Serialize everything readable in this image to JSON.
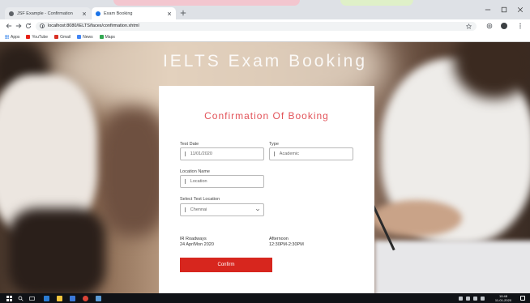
{
  "browser": {
    "tabs": [
      {
        "title": "JSF Example - Confirmation",
        "icon": "page-favicon"
      },
      {
        "title": "Exam Booking",
        "icon": "page-favicon"
      }
    ],
    "url": "localhost:8080/IELTS/faces/confirmation.xhtml",
    "bookmarks": [
      {
        "label": "Apps",
        "icon": "apps-grid-icon",
        "color": "#1a73e8"
      },
      {
        "label": "YouTube",
        "icon": "youtube-icon",
        "color": "#e62117"
      },
      {
        "label": "Gmail",
        "icon": "gmail-icon",
        "color": "#d93025"
      },
      {
        "label": "News",
        "icon": "news-icon",
        "color": "#4285f4"
      },
      {
        "label": "Maps",
        "icon": "maps-icon",
        "color": "#34a853"
      }
    ]
  },
  "page": {
    "title": "IELTS Exam Booking"
  },
  "booking": {
    "heading": "Confirmation Of Booking",
    "test_date": {
      "label": "Test Date",
      "value": "11/01/2020"
    },
    "type": {
      "label": "Type",
      "value": "Academic"
    },
    "location_name": {
      "label": "Location Name",
      "value": "Location"
    },
    "test_location": {
      "label": "Select Test Location",
      "value": "Chennai"
    },
    "slot_left": {
      "line1": "IR Roadways",
      "line2": "24 Apr/Mon 2020"
    },
    "slot_right": {
      "line1": "Afternoon",
      "line2": "12:30PM-2:30PM"
    },
    "confirm_label": "Confirm"
  },
  "taskbar": {
    "time": "10:48",
    "date": "11-01-2020",
    "apps": [
      {
        "icon": "edge-icon",
        "color": "#2b7cd3"
      },
      {
        "icon": "file-explorer-icon",
        "color": "#f2c53d"
      },
      {
        "icon": "store-icon",
        "color": "#3b78d8"
      },
      {
        "icon": "chrome-icon",
        "color": "#db4437"
      },
      {
        "icon": "mail-icon",
        "color": "#5b9bd5"
      }
    ]
  },
  "colors": {
    "accent": "#d7261e",
    "heading": "#e2545a",
    "taskbar": "#101216"
  }
}
